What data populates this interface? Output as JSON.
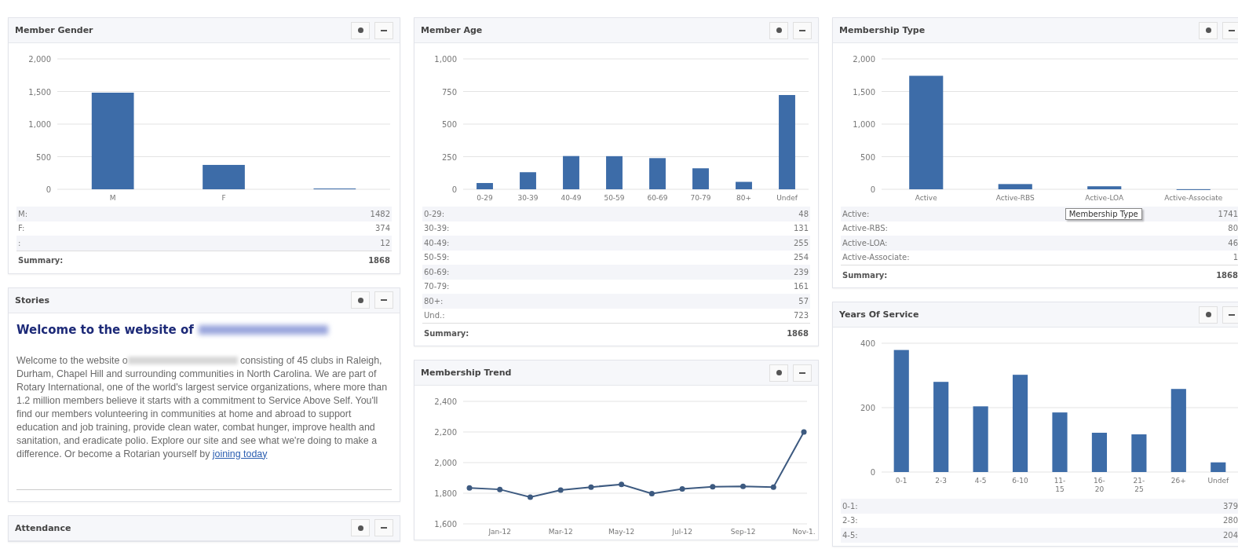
{
  "columns": [
    {
      "panels": [
        {
          "kind": "chart_table",
          "title": "Member Gender",
          "chart_data": {
            "type": "bar",
            "categories": [
              "M",
              "F",
              null
            ],
            "values": [
              1482,
              374,
              12
            ],
            "ylim": [
              0,
              2000
            ],
            "grid": true,
            "yticks": [
              0,
              500,
              {
                "value": 1000,
                "label": "1,000"
              },
              {
                "value": 1500,
                "label": "1,500"
              },
              {
                "value": 2000,
                "label": "2,000"
              }
            ]
          },
          "rows": [
            {
              "label": "M:",
              "value": "1482"
            },
            {
              "label": "F:",
              "value": "374"
            },
            {
              "label": ":",
              "value": "12"
            }
          ],
          "summary": {
            "label": "Summary:",
            "value": "1868"
          }
        },
        {
          "kind": "stories",
          "title": "Stories",
          "heading": "Welcome to the website of",
          "paragraph_start": "Welcome to the website o",
          "paragraph_end": "consisting of 45 clubs in Raleigh, Durham, Chapel Hill and surrounding communities in North Carolina. We are part of Rotary International, one of the world's largest service organizations, where more than 1.2 million members believe it starts with a commitment to Service Above Self. You'll find our members volunteering in communities at home and abroad to support education and job training, provide clean water, combat hunger, improve health and sanitation, and eradicate polio. Explore our site and see what we're doing to make a difference.  Or become a Rotarian yourself by",
          "link": "joining today"
        },
        {
          "kind": "header_only",
          "title": "Attendance"
        }
      ]
    },
    {
      "panels": [
        {
          "kind": "chart_table",
          "title": "Member Age",
          "chart_data": {
            "type": "bar",
            "categories": [
              "0-29",
              "30-39",
              "40-49",
              "50-59",
              "60-69",
              "70-79",
              "80+",
              "Undef"
            ],
            "values": [
              48,
              131,
              255,
              254,
              239,
              161,
              57,
              723
            ],
            "ylim": [
              0,
              1000
            ],
            "grid": true,
            "yticks": [
              0,
              250,
              500,
              750,
              {
                "value": 1000,
                "label": "1,000"
              }
            ]
          },
          "rows": [
            {
              "label": "0-29:",
              "value": "48"
            },
            {
              "label": "30-39:",
              "value": "131"
            },
            {
              "label": "40-49:",
              "value": "255"
            },
            {
              "label": "50-59:",
              "value": "254"
            },
            {
              "label": "60-69:",
              "value": "239"
            },
            {
              "label": "70-79:",
              "value": "161"
            },
            {
              "label": "80+:",
              "value": "57"
            },
            {
              "label": "Und.:",
              "value": "723"
            }
          ],
          "summary": {
            "label": "Summary:",
            "value": "1868"
          }
        },
        {
          "kind": "chart",
          "title": "Membership Trend",
          "chart_data": {
            "type": "line",
            "categories": [
              null,
              "Jan-12",
              null,
              "Mar-12",
              null,
              "May-12",
              null,
              "Jul-12",
              null,
              "Sep-12",
              null,
              "Nov-1."
            ],
            "series": [
              {
                "color": "#3d5a80",
                "marker": "circle",
                "values": [
                  1835,
                  1825,
                  1775,
                  1820,
                  1840,
                  1858,
                  1798,
                  1828,
                  1842,
                  1845,
                  1840,
                  2200
                ]
              }
            ],
            "ylim": [
              1600,
              2400
            ],
            "grid": true,
            "yticks": [
              {
                "value": 1600,
                "label": "1,600"
              },
              {
                "value": 1800,
                "label": "1,800"
              },
              {
                "value": 2000,
                "label": "2,000"
              },
              {
                "value": 2200,
                "label": "2,200"
              },
              {
                "value": 2400,
                "label": "2,400"
              }
            ]
          }
        }
      ]
    },
    {
      "panels": [
        {
          "kind": "chart_table",
          "title": "Membership Type",
          "chart_data": {
            "type": "bar",
            "categories": [
              "Active",
              "Active-RBS",
              "Active-LOA",
              "Active-Associate"
            ],
            "values": [
              1741,
              80,
              46,
              1
            ],
            "ylim": [
              0,
              2000
            ],
            "grid": true,
            "yticks": [
              0,
              500,
              {
                "value": 1000,
                "label": "1,000"
              },
              {
                "value": 1500,
                "label": "1,500"
              },
              {
                "value": 2000,
                "label": "2,000"
              }
            ]
          },
          "rows": [
            {
              "label": "Active:",
              "value": "1741"
            },
            {
              "label": "Active-RBS:",
              "value": "80"
            },
            {
              "label": "Active-LOA:",
              "value": "46"
            },
            {
              "label": "Active-Associate:",
              "value": "1"
            }
          ],
          "summary": {
            "label": "Summary:",
            "value": "1868"
          },
          "tooltip": "Membership Type"
        },
        {
          "kind": "chart_table",
          "title": "Years Of Service",
          "chart_data": {
            "type": "bar",
            "categories": [
              "0-1",
              "2-3",
              "4-5",
              "6-10",
              "11- 15",
              "16- 20",
              "21- 25",
              "26+",
              "Undef"
            ],
            "values": [
              379,
              280,
              204,
              302,
              185,
              122,
              117,
              258,
              30
            ],
            "ylim": [
              0,
              400
            ],
            "grid": true,
            "yticks": [
              0,
              200,
              400
            ]
          },
          "rows": [
            {
              "label": "0-1:",
              "value": "379"
            },
            {
              "label": "2-3:",
              "value": "280"
            },
            {
              "label": "4-5:",
              "value": "204"
            }
          ]
        }
      ]
    }
  ]
}
